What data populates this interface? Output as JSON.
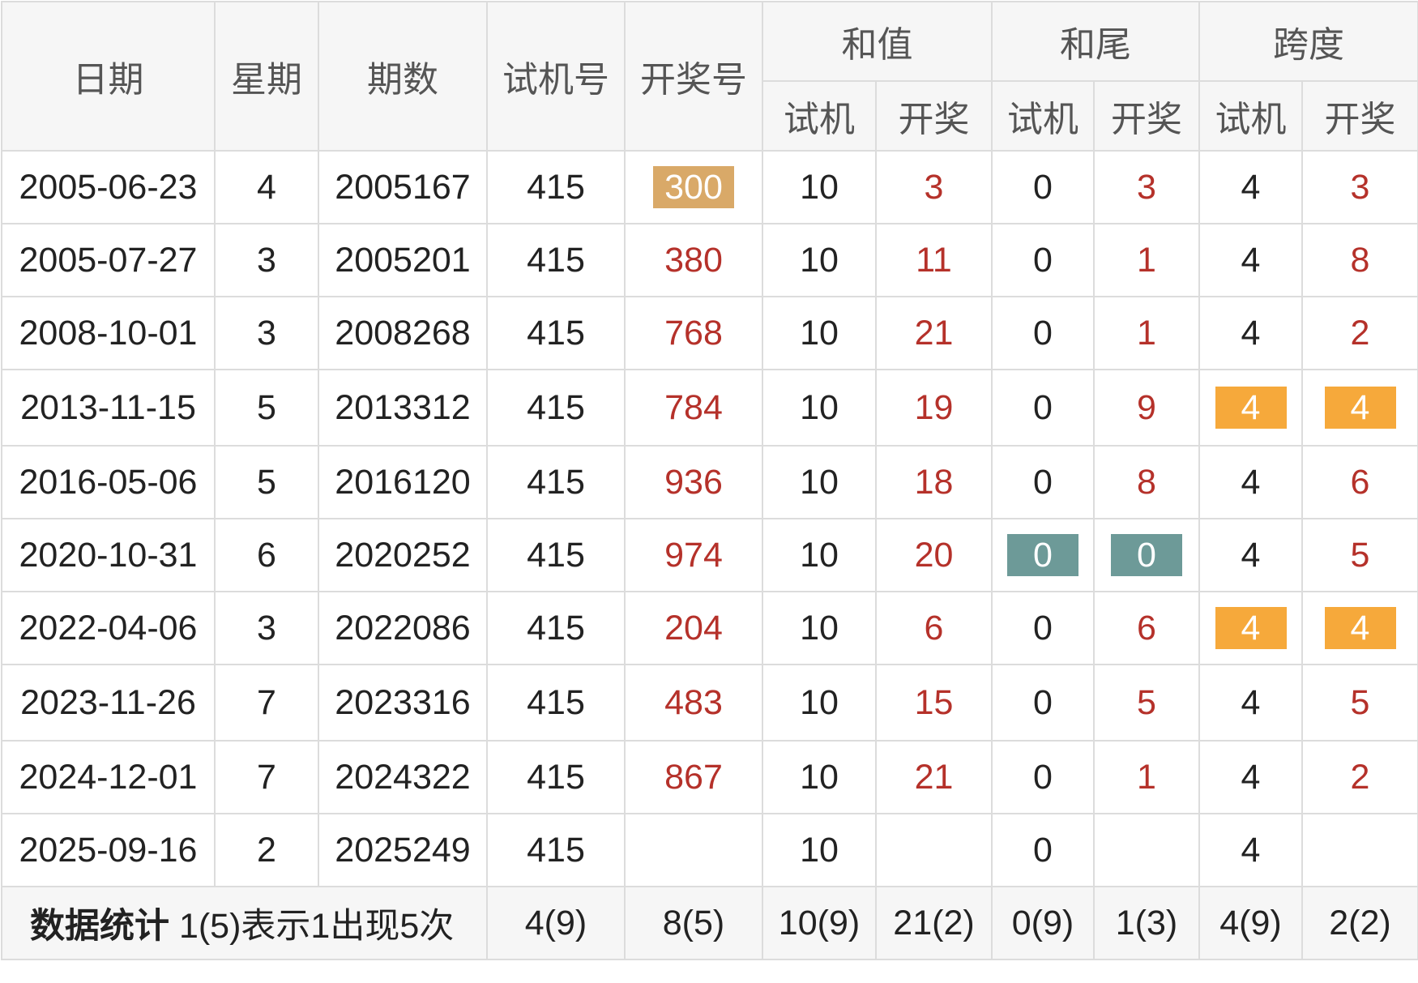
{
  "headers": {
    "date": "日期",
    "weekday": "星期",
    "issue": "期数",
    "test_number": "试机号",
    "draw_number": "开奖号",
    "sum": "和值",
    "sum_tail": "和尾",
    "span": "跨度",
    "sub_test": "试机",
    "sub_draw": "开奖"
  },
  "rows": [
    {
      "date": "2005-06-23",
      "weekday": "4",
      "issue": "2005167",
      "test": "415",
      "draw": "300",
      "sum_test": "10",
      "sum_draw": "3",
      "tail_test": "0",
      "tail_draw": "3",
      "span_test": "4",
      "span_draw": "3"
    },
    {
      "date": "2005-07-27",
      "weekday": "3",
      "issue": "2005201",
      "test": "415",
      "draw": "380",
      "sum_test": "10",
      "sum_draw": "11",
      "tail_test": "0",
      "tail_draw": "1",
      "span_test": "4",
      "span_draw": "8"
    },
    {
      "date": "2008-10-01",
      "weekday": "3",
      "issue": "2008268",
      "test": "415",
      "draw": "768",
      "sum_test": "10",
      "sum_draw": "21",
      "tail_test": "0",
      "tail_draw": "1",
      "span_test": "4",
      "span_draw": "2"
    },
    {
      "date": "2013-11-15",
      "weekday": "5",
      "issue": "2013312",
      "test": "415",
      "draw": "784",
      "sum_test": "10",
      "sum_draw": "19",
      "tail_test": "0",
      "tail_draw": "9",
      "span_test": "4",
      "span_draw": "4"
    },
    {
      "date": "2016-05-06",
      "weekday": "5",
      "issue": "2016120",
      "test": "415",
      "draw": "936",
      "sum_test": "10",
      "sum_draw": "18",
      "tail_test": "0",
      "tail_draw": "8",
      "span_test": "4",
      "span_draw": "6"
    },
    {
      "date": "2020-10-31",
      "weekday": "6",
      "issue": "2020252",
      "test": "415",
      "draw": "974",
      "sum_test": "10",
      "sum_draw": "20",
      "tail_test": "0",
      "tail_draw": "0",
      "span_test": "4",
      "span_draw": "5"
    },
    {
      "date": "2022-04-06",
      "weekday": "3",
      "issue": "2022086",
      "test": "415",
      "draw": "204",
      "sum_test": "10",
      "sum_draw": "6",
      "tail_test": "0",
      "tail_draw": "6",
      "span_test": "4",
      "span_draw": "4"
    },
    {
      "date": "2023-11-26",
      "weekday": "7",
      "issue": "2023316",
      "test": "415",
      "draw": "483",
      "sum_test": "10",
      "sum_draw": "15",
      "tail_test": "0",
      "tail_draw": "5",
      "span_test": "4",
      "span_draw": "5"
    },
    {
      "date": "2024-12-01",
      "weekday": "7",
      "issue": "2024322",
      "test": "415",
      "draw": "867",
      "sum_test": "10",
      "sum_draw": "21",
      "tail_test": "0",
      "tail_draw": "1",
      "span_test": "4",
      "span_draw": "2"
    },
    {
      "date": "2025-09-16",
      "weekday": "2",
      "issue": "2025249",
      "test": "415",
      "draw": "",
      "sum_test": "10",
      "sum_draw": "",
      "tail_test": "0",
      "tail_draw": "",
      "span_test": "4",
      "span_draw": ""
    }
  ],
  "stats": {
    "label": "数据统计",
    "note": "1(5)表示1出现5次",
    "test": "4(9)",
    "draw": "8(5)",
    "sum_test": "10(9)",
    "sum_draw": "21(2)",
    "tail_test": "0(9)",
    "tail_draw": "1(3)",
    "span_test": "4(9)",
    "span_draw": "2(2)"
  },
  "highlight_colors": {
    "tan": "#d9a968",
    "orange": "#f6a93b",
    "teal": "#6d9a98",
    "red_text": "#b5312a",
    "stats_text": "#3d6aa3"
  }
}
